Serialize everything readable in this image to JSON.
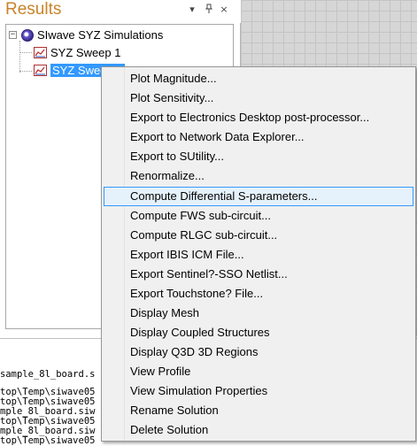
{
  "panel": {
    "title": "Results",
    "header_buttons": [
      "▾",
      "ᵖ",
      "×"
    ]
  },
  "tree": {
    "root_expander": "−",
    "root_label": "SIwave SYZ Simulations",
    "items": [
      {
        "label": "SYZ Sweep 1",
        "selected": false
      },
      {
        "label": "SYZ Sweep 2",
        "selected": true
      }
    ]
  },
  "context_menu": {
    "items": [
      {
        "label": "Plot Magnitude...",
        "highlighted": false
      },
      {
        "label": "Plot Sensitivity...",
        "highlighted": false
      },
      {
        "label": "Export to Electronics Desktop post-processor...",
        "highlighted": false
      },
      {
        "label": "Export to Network Data Explorer...",
        "highlighted": false
      },
      {
        "label": "Export to SUtility...",
        "highlighted": false
      },
      {
        "label": "Renormalize...",
        "highlighted": false
      },
      {
        "label": "Compute Differential S-parameters...",
        "highlighted": true
      },
      {
        "label": "Compute FWS sub-circuit...",
        "highlighted": false
      },
      {
        "label": "Compute RLGC sub-circuit...",
        "highlighted": false
      },
      {
        "label": "Export IBIS ICM File...",
        "highlighted": false
      },
      {
        "label": "Export Sentinel?-SSO Netlist...",
        "highlighted": false
      },
      {
        "label": "Export Touchstone? File...",
        "highlighted": false
      },
      {
        "label": "Display Mesh",
        "highlighted": false
      },
      {
        "label": "Display Coupled Structures",
        "highlighted": false
      },
      {
        "label": "Display Q3D 3D Regions",
        "highlighted": false
      },
      {
        "label": "View Profile",
        "highlighted": false
      },
      {
        "label": "View Simulation Properties",
        "highlighted": false
      },
      {
        "label": "Rename Solution",
        "highlighted": false
      },
      {
        "label": "Delete Solution",
        "highlighted": false
      }
    ]
  },
  "output": {
    "lines": [
      "sample_8l_board.s",
      "top\\Temp\\siwave05",
      "top\\Temp\\siwave05",
      "mple_8l_board.siw",
      "top\\Temp\\siwave05",
      "mple_8l_board.siw",
      "top\\Temp\\siwave05"
    ]
  }
}
